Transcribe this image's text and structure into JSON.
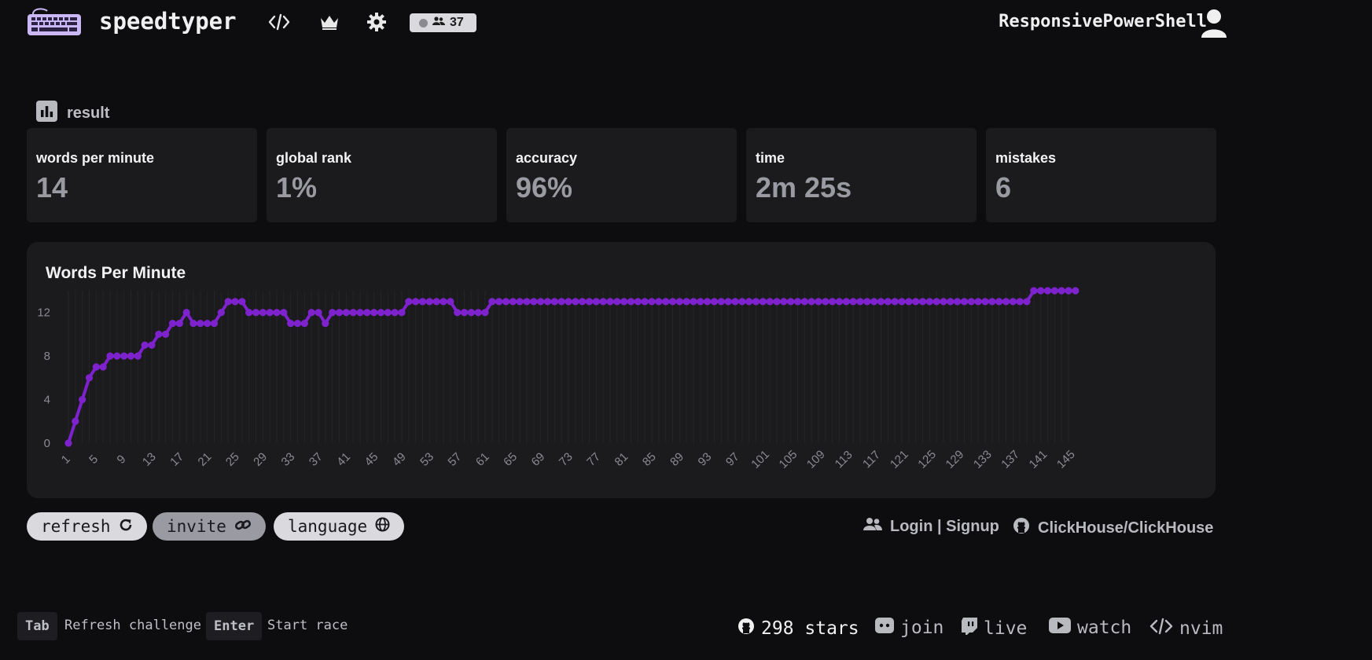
{
  "header": {
    "brand": "speedtyper",
    "online_count": "37",
    "username": "ResponsivePowerShell"
  },
  "result": {
    "label": "result",
    "stats": [
      {
        "label": "words per minute",
        "value": "14"
      },
      {
        "label": "global rank",
        "value": "1%"
      },
      {
        "label": "accuracy",
        "value": "96%"
      },
      {
        "label": "time",
        "value": "2m 25s"
      },
      {
        "label": "mistakes",
        "value": "6"
      }
    ]
  },
  "chart_data": {
    "type": "line",
    "title": "Words Per Minute",
    "xlabel": "",
    "ylabel": "",
    "ylim": [
      0,
      14
    ],
    "yticks": [
      0,
      4,
      8,
      12
    ],
    "xtick_labels": [
      "1",
      "5",
      "9",
      "13",
      "17",
      "21",
      "25",
      "29",
      "33",
      "37",
      "41",
      "45",
      "49",
      "53",
      "57",
      "61",
      "65",
      "69",
      "73",
      "77",
      "81",
      "85",
      "89",
      "93",
      "97",
      "101",
      "105",
      "109",
      "113",
      "117",
      "121",
      "125",
      "129",
      "133",
      "137",
      "141",
      "145"
    ],
    "x_start": 1,
    "x_end": 145,
    "series": [
      {
        "color": "#7e22ce",
        "values": [
          0,
          2,
          4,
          6,
          7,
          7,
          8,
          8,
          8,
          8,
          8,
          9,
          9,
          10,
          10,
          11,
          11,
          12,
          11,
          11,
          11,
          11,
          12,
          13,
          13,
          13,
          12,
          12,
          12,
          12,
          12,
          12,
          11,
          11,
          11,
          12,
          12,
          11,
          12,
          12,
          12,
          12,
          12,
          12,
          12,
          12,
          12,
          12,
          12,
          13,
          13,
          13,
          13,
          13,
          13,
          13,
          12,
          12,
          12,
          12,
          12,
          13,
          13,
          13,
          13,
          13,
          13,
          13,
          13,
          13,
          13,
          13,
          13,
          13,
          13,
          13,
          13,
          13,
          13,
          13,
          13,
          13,
          13,
          13,
          13,
          13,
          13,
          13,
          13,
          13,
          13,
          13,
          13,
          13,
          13,
          13,
          13,
          13,
          13,
          13,
          13,
          13,
          13,
          13,
          13,
          13,
          13,
          13,
          13,
          13,
          13,
          13,
          13,
          13,
          13,
          13,
          13,
          13,
          13,
          13,
          13,
          13,
          13,
          13,
          13,
          13,
          13,
          13,
          13,
          13,
          13,
          13,
          13,
          13,
          13,
          13,
          13,
          13,
          13,
          14,
          14,
          14,
          14,
          14,
          14,
          14
        ]
      }
    ],
    "grid": true,
    "legend": "none"
  },
  "actions": {
    "refresh": "refresh",
    "invite": "invite",
    "language": "language",
    "login": "Login | Signup",
    "repo": "ClickHouse/ClickHouse"
  },
  "footer": {
    "tab_key": "Tab",
    "tab_desc": "Refresh challenge",
    "enter_key": "Enter",
    "enter_desc": "Start race",
    "stars": "298 stars",
    "join": "join",
    "live": "live",
    "watch": "watch",
    "nvim": "nvim"
  }
}
